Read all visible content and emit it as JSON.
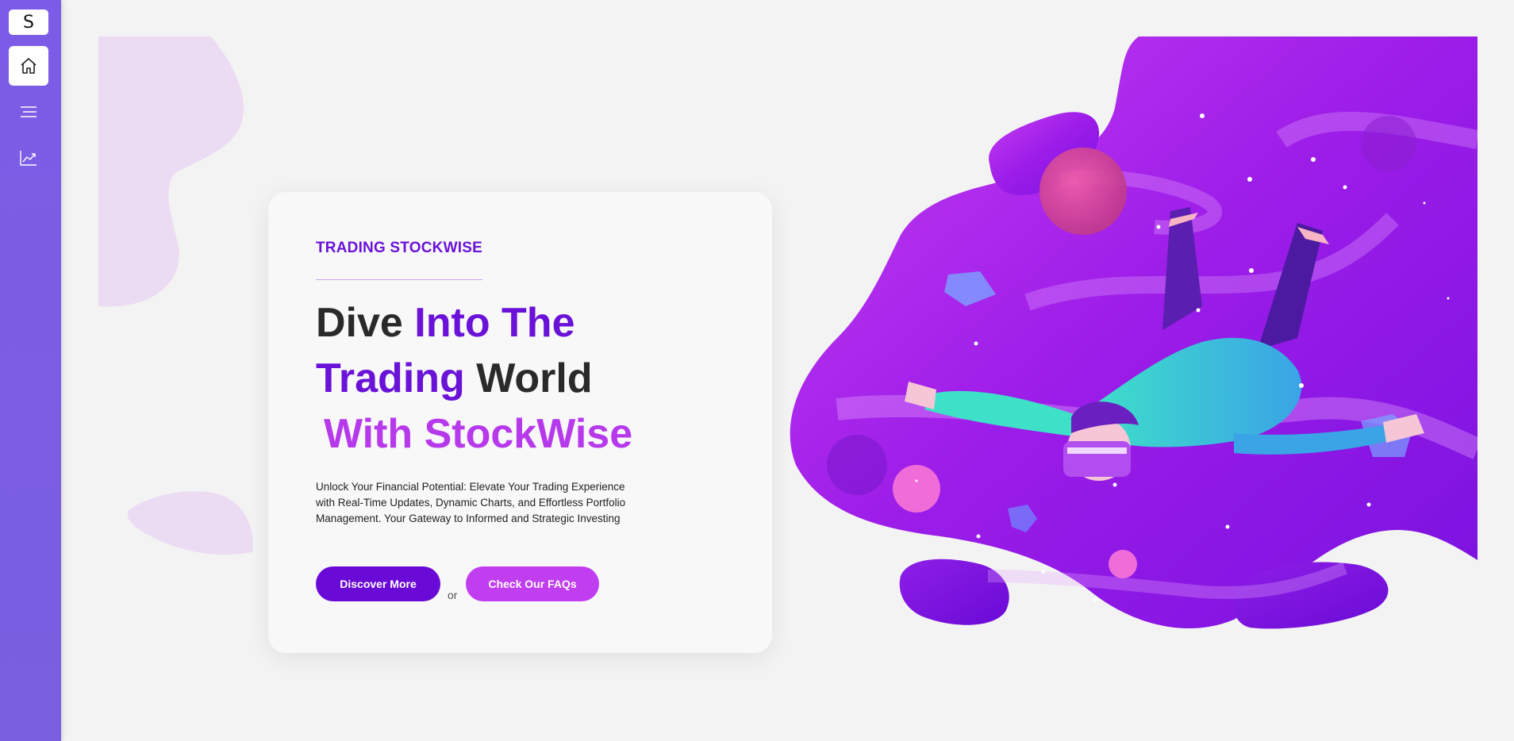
{
  "sidebar": {
    "logo_letter": "S",
    "items": [
      {
        "icon": "home-icon",
        "active": true
      },
      {
        "icon": "menu-icon",
        "active": false
      },
      {
        "icon": "chart-icon",
        "active": false
      }
    ]
  },
  "hero": {
    "eyebrow": "TRADING STOCKWISE",
    "headline": {
      "part1": "Dive ",
      "part2": "Into The",
      "part3": "Trading",
      "part4": " World",
      "part5": "With StockWise"
    },
    "description": "Unlock Your Financial Potential: Elevate Your Trading Experience with Real-Time Updates, Dynamic Charts, and Effortless Portfolio Management. Your Gateway to Informed and Strategic Investing",
    "primary_button": "Discover More",
    "separator": "or",
    "secondary_button": "Check Our FAQs"
  },
  "colors": {
    "sidebar": "#7c5ce6",
    "accent_dark": "#6a12d8",
    "accent_light": "#b739ec",
    "button_primary": "#6a0ad6",
    "button_secondary": "#c13ef0"
  }
}
